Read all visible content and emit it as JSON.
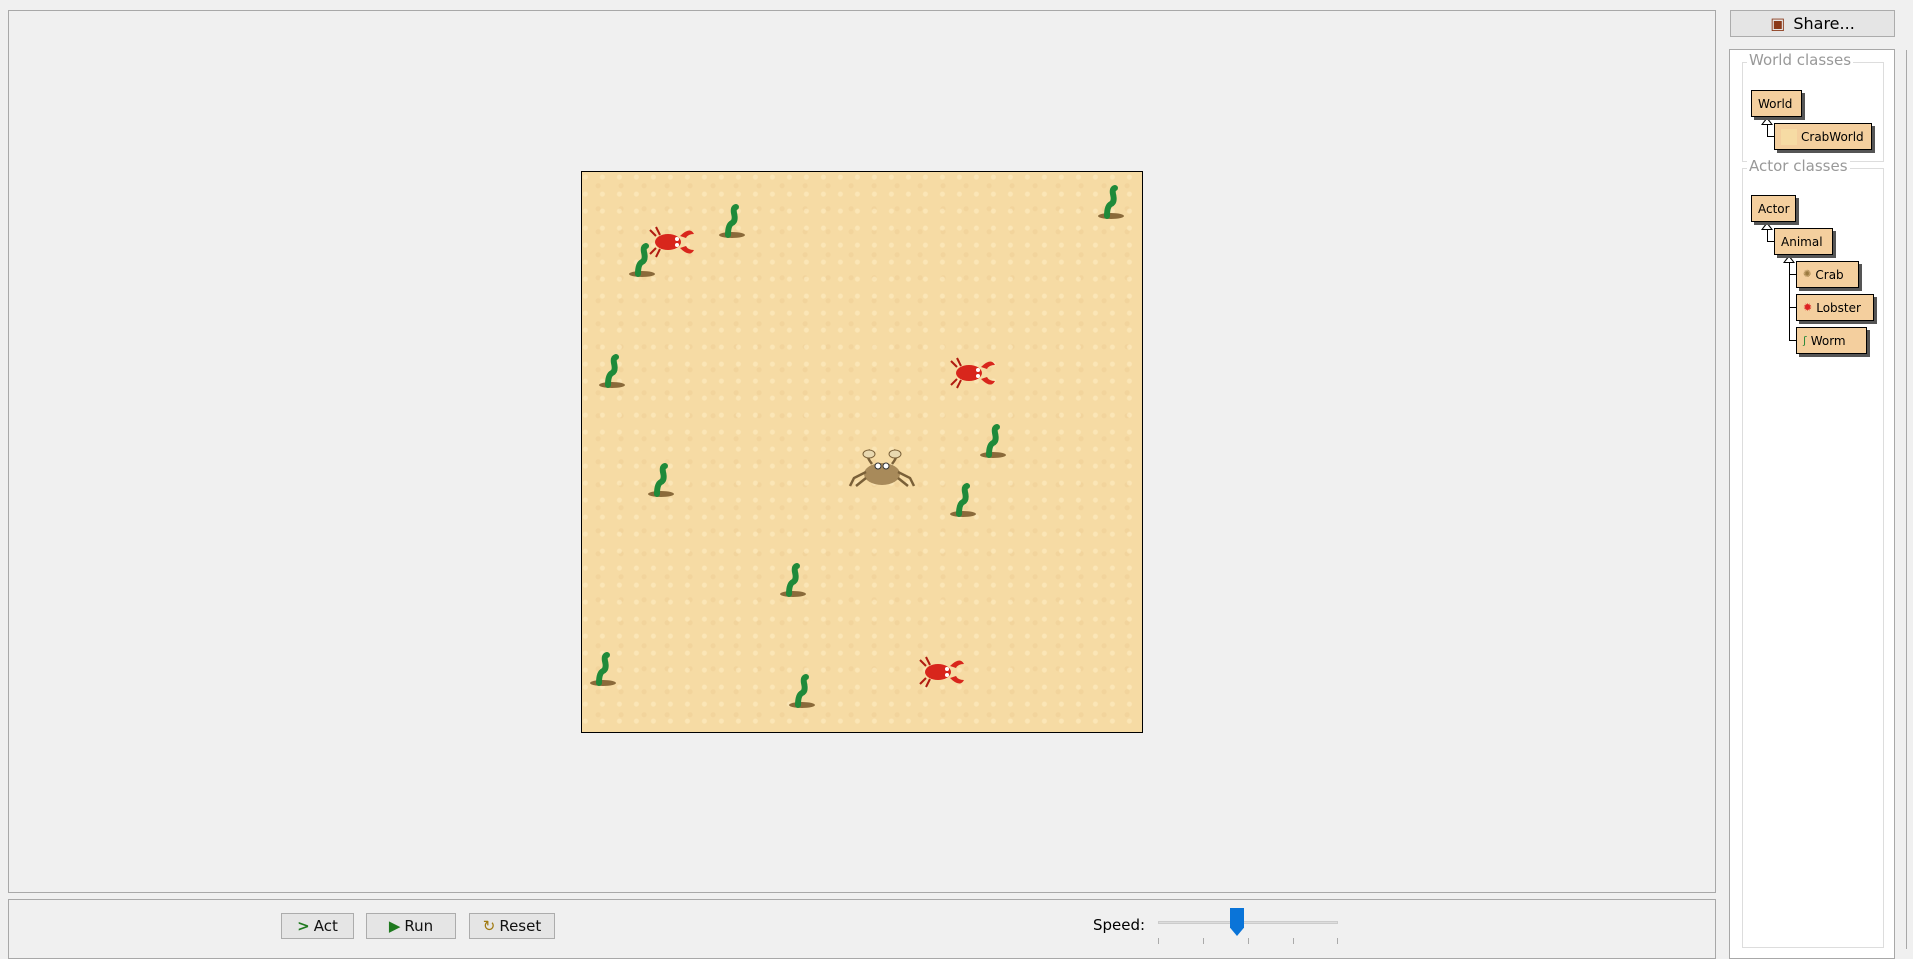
{
  "controls": {
    "act_label": "Act",
    "run_label": "Run",
    "reset_label": "Reset",
    "speed_label": "Speed:",
    "speed_value": 0.5
  },
  "share": {
    "label": "Share..."
  },
  "classes": {
    "world_title": "World classes",
    "world": [
      "World",
      "CrabWorld"
    ],
    "actor_title": "Actor classes",
    "actor": [
      "Actor",
      "Animal",
      "Crab",
      "Lobster",
      "Worm"
    ]
  },
  "colors": {
    "sand": "#f6dba4",
    "class_box": "#f4cf9e",
    "slider": "#0a74d8"
  }
}
